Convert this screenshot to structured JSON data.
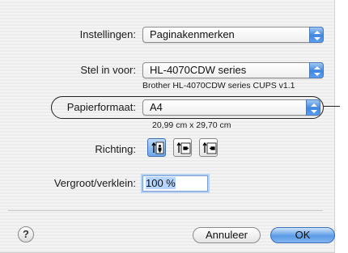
{
  "settings": {
    "label": "Instellingen:",
    "value": "Paginakenmerken"
  },
  "format_for": {
    "label": "Stel in voor:",
    "value": "HL-4070CDW series",
    "detail": "Brother HL-4070CDW series CUPS v1.1"
  },
  "paper_size": {
    "label": "Papierformaat:",
    "value": "A4",
    "dimensions": "20,99 cm x 29,70 cm"
  },
  "orientation": {
    "label": "Richting:",
    "options": [
      {
        "name": "portrait",
        "selected": true
      },
      {
        "name": "landscape",
        "selected": false
      },
      {
        "name": "landscape-reversed",
        "selected": false
      }
    ]
  },
  "scale": {
    "label": "Vergroot/verklein:",
    "value": "100 %"
  },
  "footer": {
    "help": "?",
    "cancel": "Annuleer",
    "ok": "OK"
  },
  "colors": {
    "accent": "#3f86e0"
  }
}
